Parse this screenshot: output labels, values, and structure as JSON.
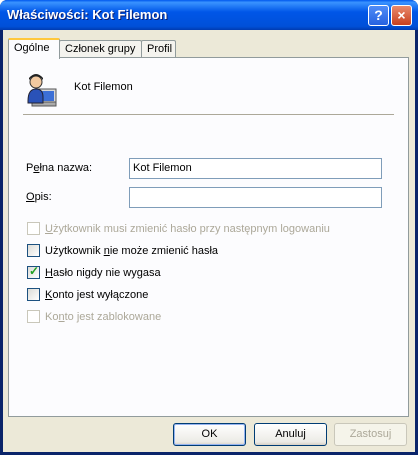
{
  "window": {
    "title": "Właściwości: Kot Filemon",
    "help_glyph": "?",
    "close_glyph": "×"
  },
  "tabs": [
    {
      "label": "Ogólne",
      "active": true
    },
    {
      "label": "Członek grupy",
      "active": false
    },
    {
      "label": "Profil",
      "active": false
    }
  ],
  "general": {
    "user_name": "Kot Filemon",
    "full_name_label": "Pełna nazwa:",
    "full_name_value": "Kot Filemon",
    "description_label": "Opis:",
    "description_value": "",
    "checkboxes": [
      {
        "label": "Użytkownik musi zmienić hasło przy następnym logowaniu",
        "checked": false,
        "enabled": false
      },
      {
        "label": "Użytkownik nie może zmienić hasła",
        "checked": false,
        "enabled": true
      },
      {
        "label": "Hasło nigdy nie wygasa",
        "checked": true,
        "enabled": true
      },
      {
        "label": "Konto jest wyłączone",
        "checked": false,
        "enabled": true
      },
      {
        "label": "Konto jest zablokowane",
        "checked": false,
        "enabled": false
      }
    ]
  },
  "buttons": {
    "ok": "OK",
    "cancel": "Anuluj",
    "apply": "Zastosuj"
  },
  "colors": {
    "titlebar": "#0054e3",
    "face": "#ece9d8",
    "check": "#21a121"
  }
}
